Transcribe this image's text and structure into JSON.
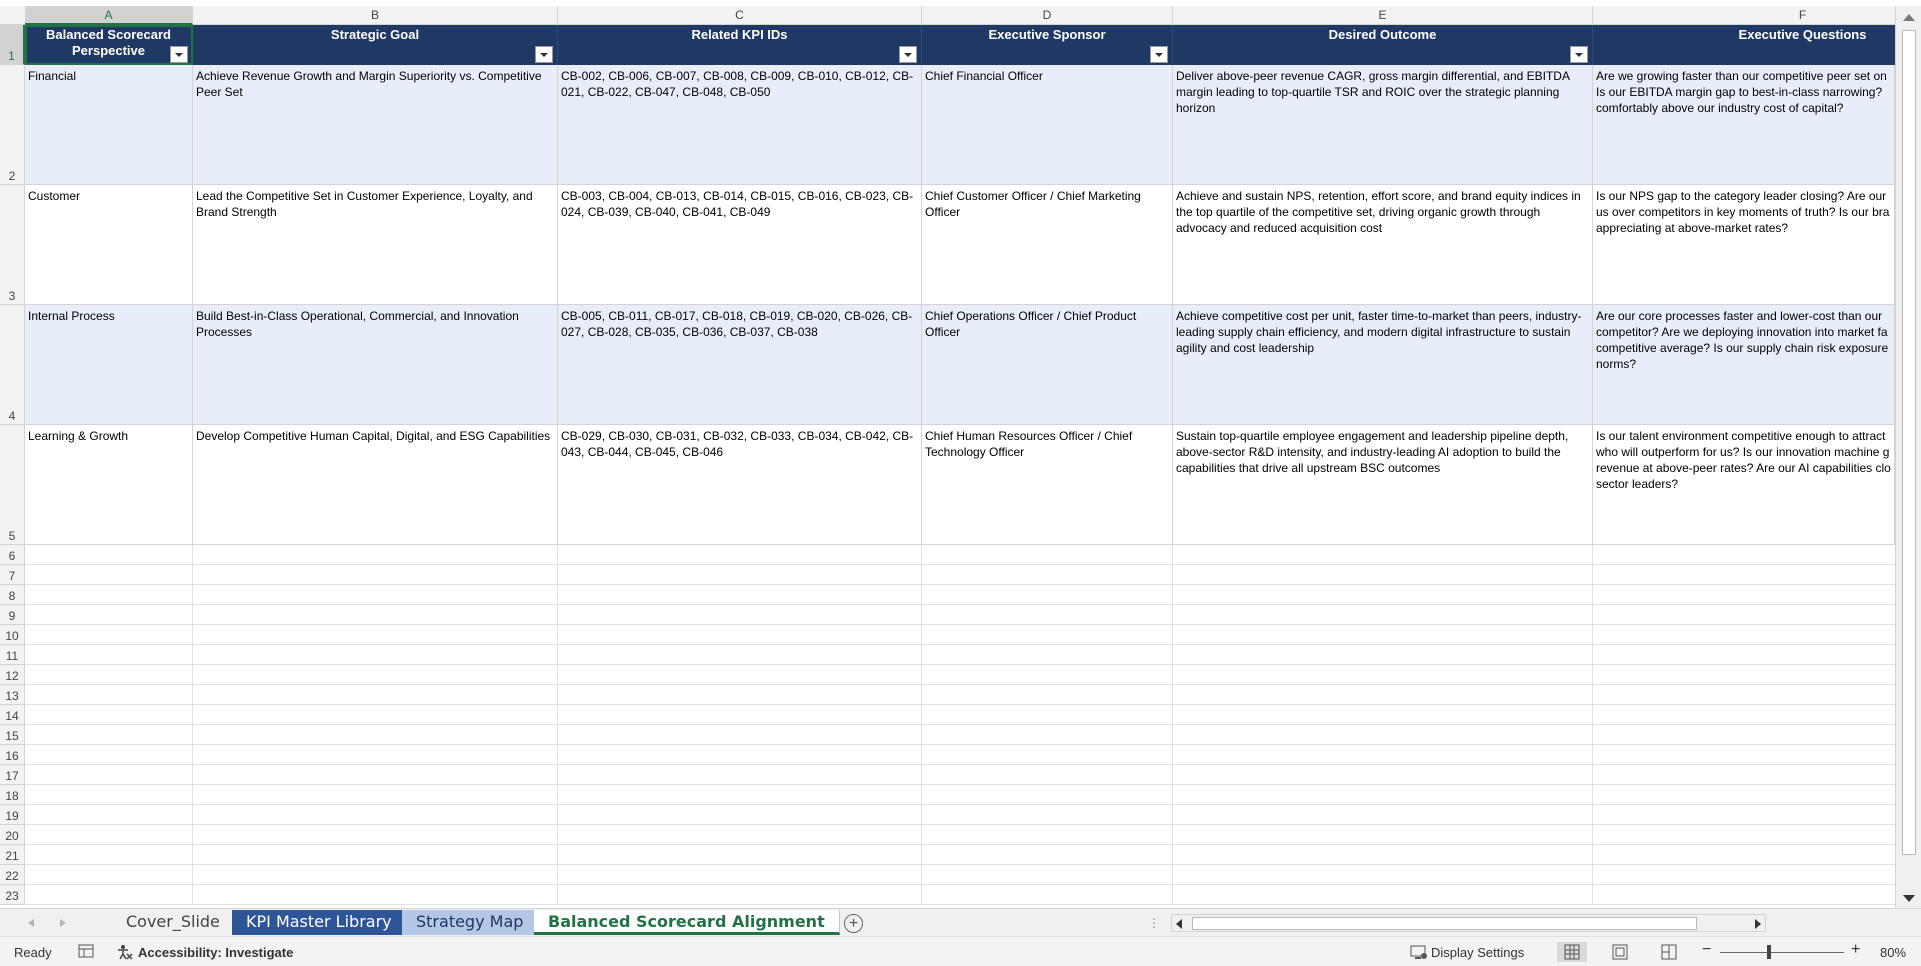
{
  "columns": [
    "A",
    "B",
    "C",
    "D",
    "E",
    "F"
  ],
  "row_numbers": [
    "1",
    "2",
    "3",
    "4",
    "5",
    "6",
    "7",
    "8",
    "9",
    "10",
    "11",
    "12",
    "13",
    "14",
    "15",
    "16",
    "17",
    "18",
    "19",
    "20",
    "21",
    "22",
    "23"
  ],
  "headers": {
    "a": "Balanced Scorecard Perspective",
    "b": "Strategic Goal",
    "c": "Related KPI IDs",
    "d": "Executive Sponsor",
    "e": "Desired Outcome",
    "f": "Executive Questions"
  },
  "rows": [
    {
      "perspective": "Financial",
      "goal": "Achieve Revenue Growth and Margin Superiority vs. Competitive Peer Set",
      "kpis": "CB-002, CB-006, CB-007, CB-008, CB-009, CB-010, CB-012, CB-021, CB-022, CB-047, CB-048, CB-050",
      "sponsor": "Chief Financial Officer",
      "outcome": "Deliver above-peer revenue CAGR, gross margin differential, and EBITDA margin leading to top-quartile TSR and ROIC over the strategic planning horizon",
      "questions": "Are we growing faster than our competitive peer set on Is our EBITDA margin gap to best-in-class narrowing? comfortably above our industry cost of capital?"
    },
    {
      "perspective": "Customer",
      "goal": "Lead the Competitive Set in Customer Experience, Loyalty, and Brand Strength",
      "kpis": "CB-003, CB-004, CB-013, CB-014, CB-015, CB-016, CB-023, CB-024, CB-039, CB-040, CB-041, CB-049",
      "sponsor": "Chief Customer Officer / Chief Marketing Officer",
      "outcome": "Achieve and sustain NPS, retention, effort score, and brand equity indices in the top quartile of the competitive set, driving organic growth through advocacy and reduced acquisition cost",
      "questions": "Is our NPS gap to the category leader closing? Are our us over competitors in key moments of truth? Is our bra appreciating at above-market rates?"
    },
    {
      "perspective": "Internal Process",
      "goal": "Build Best-in-Class Operational, Commercial, and Innovation Processes",
      "kpis": "CB-005, CB-011, CB-017, CB-018, CB-019, CB-020, CB-026, CB-027, CB-028, CB-035, CB-036, CB-037, CB-038",
      "sponsor": "Chief Operations Officer / Chief Product Officer",
      "outcome": "Achieve competitive cost per unit, faster time-to-market than peers, industry-leading supply chain efficiency, and modern digital infrastructure to sustain agility and cost leadership",
      "questions": "Are our core processes faster and lower-cost than our competitor? Are we deploying innovation into market fa competitive average? Is our supply chain risk exposure norms?"
    },
    {
      "perspective": "Learning & Growth",
      "goal": "Develop Competitive Human Capital, Digital, and ESG Capabilities",
      "kpis": "CB-029, CB-030, CB-031, CB-032, CB-033, CB-034, CB-042, CB-043, CB-044, CB-045, CB-046",
      "sponsor": "Chief Human Resources Officer / Chief Technology Officer",
      "outcome": "Sustain top-quartile employee engagement and leadership pipeline depth, above-sector R&D intensity, and industry-leading AI adoption to build the capabilities that drive all upstream BSC outcomes",
      "questions": "Is our talent environment competitive enough to attract who will outperform for us? Is our innovation machine g revenue at above-peer rates? Are our AI capabilities clo sector leaders?"
    }
  ],
  "tabs": {
    "cover": "Cover_Slide",
    "kpi_library": "KPI Master Library",
    "strategy_map": "Strategy Map",
    "bsc_alignment": "Balanced Scorecard Alignment"
  },
  "status": {
    "ready": "Ready",
    "accessibility": "Accessibility: Investigate",
    "display_settings": "Display Settings",
    "zoom": "80%"
  },
  "colors": {
    "header_fill": "#1f3864",
    "band_fill": "#e8eef9",
    "excel_green": "#217346",
    "tab_dark": "#2e5597",
    "tab_light": "#b4c7e7"
  },
  "icons": [
    "filter-dropdown-icon",
    "add-sheet-icon",
    "accessibility-icon",
    "display-settings-icon",
    "normal-view-icon",
    "page-layout-icon",
    "page-break-icon",
    "zoom-out-icon",
    "zoom-in-icon"
  ]
}
